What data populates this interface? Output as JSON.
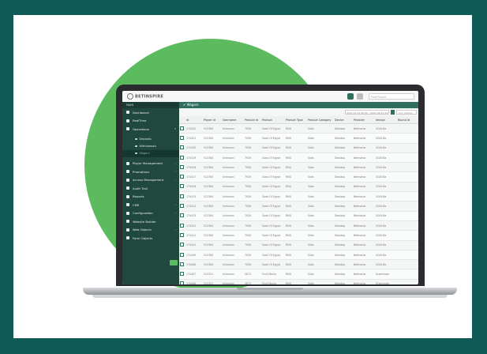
{
  "app": {
    "logo_text": "BETINSPIRE",
    "search_placeholder": "Find Player"
  },
  "sidebar": {
    "header": "MAIN",
    "items": [
      {
        "label": "Dashboard",
        "icon": "dashboard-icon"
      },
      {
        "label": "RealTime",
        "icon": "clock-icon"
      },
      {
        "label": "Operations",
        "icon": "grid-icon"
      }
    ],
    "subitems": [
      {
        "label": "Deposits"
      },
      {
        "label": "Withdrawals"
      },
      {
        "label": "Wagers"
      }
    ],
    "items2": [
      {
        "label": "Player Management"
      },
      {
        "label": "Promotions"
      },
      {
        "label": "Access Management"
      },
      {
        "label": "Audit Trail"
      },
      {
        "label": "Reports"
      },
      {
        "label": "CMS"
      },
      {
        "label": "Configuration"
      },
      {
        "label": "Website Builder"
      },
      {
        "label": "Web Objects"
      },
      {
        "label": "Form Objects"
      }
    ]
  },
  "main": {
    "page_title": "Wagers",
    "date_range": "2021-01-12 00:00 - 2021-04-12 00:00",
    "column_select": "Col. options",
    "columns": [
      "Id",
      "Player Id",
      "Username",
      "Product Id",
      "Product",
      "Product Type",
      "Product Category",
      "Device",
      "Provider",
      "Vendor",
      "Round Id"
    ],
    "rows": [
      [
        "174422",
        "512384",
        "Unknown",
        "7926",
        "Gods Of Egypt",
        "RNG",
        "Slots",
        "Desktop",
        "Betmania",
        "GGGrilla",
        ""
      ],
      [
        "174421",
        "512384",
        "Unknown",
        "7926",
        "Gods Of Egypt",
        "RNG",
        "Slots",
        "Desktop",
        "Betmania",
        "GGGrilla",
        ""
      ],
      [
        "174420",
        "512384",
        "Unknown",
        "7926",
        "Gods Of Egypt",
        "RNG",
        "Slots",
        "Desktop",
        "Betmania",
        "GGGrilla",
        ""
      ],
      [
        "174419",
        "512384",
        "Unknown",
        "7926",
        "Gods Of Egypt",
        "RNG",
        "Slots",
        "Desktop",
        "Betmania",
        "GGGrilla",
        ""
      ],
      [
        "174418",
        "512384",
        "Unknown",
        "7926",
        "Gods Of Egypt",
        "RNG",
        "Slots",
        "Desktop",
        "Betmania",
        "GGGrilla",
        ""
      ],
      [
        "174417",
        "512384",
        "Unknown",
        "7926",
        "Gods Of Egypt",
        "RNG",
        "Slots",
        "Desktop",
        "Betmania",
        "GGGrilla",
        ""
      ],
      [
        "174416",
        "512384",
        "Unknown",
        "7926",
        "Gods Of Egypt",
        "RNG",
        "Slots",
        "Desktop",
        "Betmania",
        "GGGrilla",
        ""
      ],
      [
        "174415",
        "512384",
        "Unknown",
        "7926",
        "Gods Of Egypt",
        "RNG",
        "Slots",
        "Desktop",
        "Betmania",
        "GGGrilla",
        ""
      ],
      [
        "174414",
        "512384",
        "Unknown",
        "7926",
        "Gods Of Egypt",
        "RNG",
        "Slots",
        "Desktop",
        "Betmania",
        "GGGrilla",
        ""
      ],
      [
        "174413",
        "512384",
        "Unknown",
        "7926",
        "Gods Of Egypt",
        "RNG",
        "Slots",
        "Desktop",
        "Betmania",
        "GGGrilla",
        ""
      ],
      [
        "174412",
        "512384",
        "Unknown",
        "7926",
        "Gods Of Egypt",
        "RNG",
        "Slots",
        "Desktop",
        "Betmania",
        "GGGrilla",
        ""
      ],
      [
        "174411",
        "512384",
        "Unknown",
        "7926",
        "Gods Of Egypt",
        "RNG",
        "Slots",
        "Desktop",
        "Betmania",
        "GGGrilla",
        ""
      ],
      [
        "174410",
        "512384",
        "Unknown",
        "7926",
        "Gods Of Egypt",
        "RNG",
        "Slots",
        "Desktop",
        "Betmania",
        "GGGrilla",
        ""
      ],
      [
        "174409",
        "512384",
        "Unknown",
        "7926",
        "Gods Of Egypt",
        "RNG",
        "Slots",
        "Desktop",
        "Betmania",
        "GGGrilla",
        ""
      ],
      [
        "174408",
        "512384",
        "Unknown",
        "7926",
        "Gods Of Egypt",
        "RNG",
        "Slots",
        "Desktop",
        "Betmania",
        "GGGrilla",
        ""
      ],
      [
        "174407",
        "512321",
        "Unknown",
        "5872",
        "Fruit Mania",
        "RNG",
        "Slots",
        "Desktop",
        "Betmania",
        "Greentube",
        ""
      ],
      [
        "174406",
        "512321",
        "Unknown",
        "5872",
        "Fruit Mania",
        "RNG",
        "Slots",
        "Desktop",
        "Betmania",
        "Greentube",
        ""
      ]
    ]
  },
  "colors": {
    "frame": "#0d5a57",
    "circle": "#5cbb5f",
    "sidebar": "#21483f",
    "accent": "#2f6f5e"
  }
}
